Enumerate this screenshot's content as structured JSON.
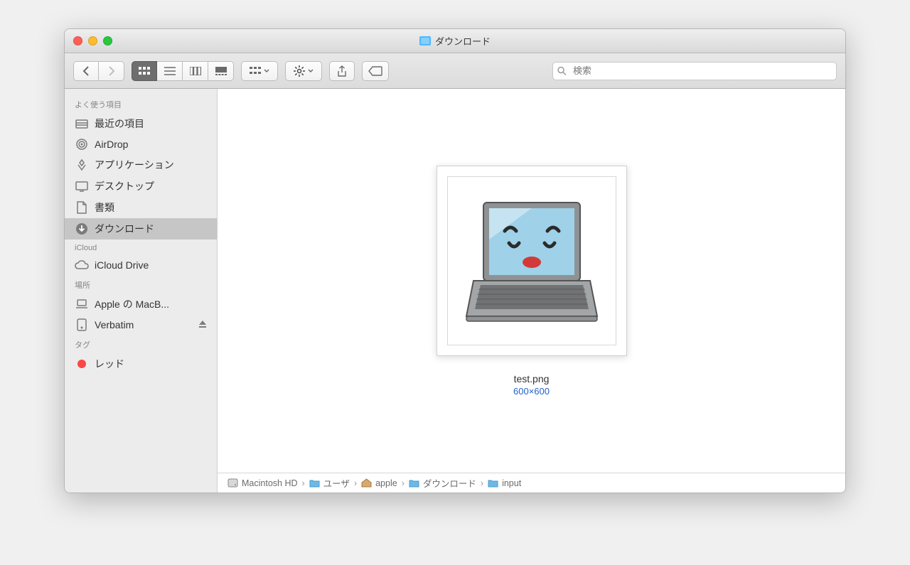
{
  "window": {
    "title": "ダウンロード"
  },
  "search": {
    "placeholder": "検索"
  },
  "sidebar": {
    "sections": [
      {
        "header": "よく使う項目",
        "items": [
          {
            "icon": "recent",
            "label": "最近の項目"
          },
          {
            "icon": "airdrop",
            "label": "AirDrop"
          },
          {
            "icon": "apps",
            "label": "アプリケーション"
          },
          {
            "icon": "desktop",
            "label": "デスクトップ"
          },
          {
            "icon": "documents",
            "label": "書類"
          },
          {
            "icon": "downloads",
            "label": "ダウンロード",
            "selected": true
          }
        ]
      },
      {
        "header": "iCloud",
        "items": [
          {
            "icon": "cloud",
            "label": "iCloud Drive"
          }
        ]
      },
      {
        "header": "場所",
        "items": [
          {
            "icon": "laptop",
            "label": "Apple の MacB..."
          },
          {
            "icon": "disk",
            "label": "Verbatim",
            "eject": true
          }
        ]
      },
      {
        "header": "タグ",
        "items": [
          {
            "icon": "tag",
            "color": "#fc4645",
            "label": "レッド"
          }
        ]
      }
    ]
  },
  "file": {
    "name": "test.png",
    "dimensions": "600×600"
  },
  "path": [
    {
      "icon": "hdd",
      "label": "Macintosh HD"
    },
    {
      "icon": "folder-blue",
      "label": "ユーザ"
    },
    {
      "icon": "home",
      "label": "apple"
    },
    {
      "icon": "folder-blue",
      "label": "ダウンロード"
    },
    {
      "icon": "folder-blue",
      "label": "input"
    }
  ]
}
